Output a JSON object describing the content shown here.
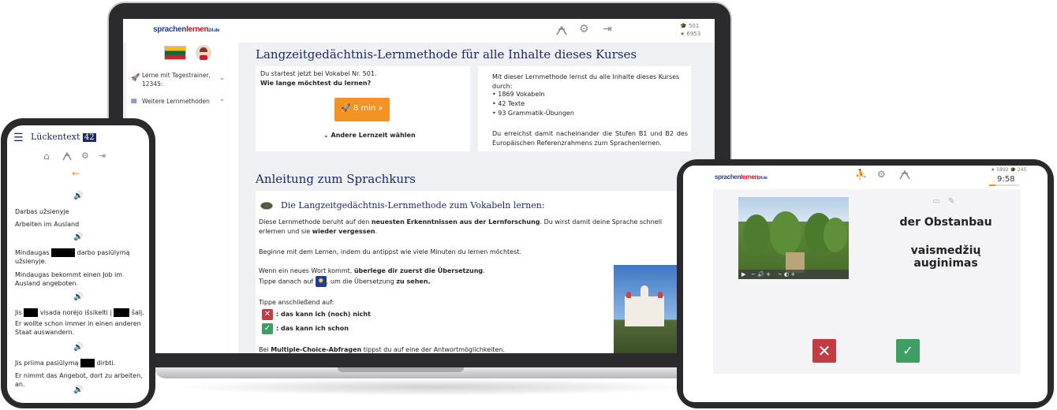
{
  "laptop": {
    "logo_a": "sprachen",
    "logo_b": "lernen",
    "logo_c": "24.de",
    "stats": {
      "line1": "501",
      "line2": "6953"
    },
    "sidebar": {
      "item1": "Lerne mit Tagestrainer, 12345:",
      "item2": "Weitere Lernmethoden"
    },
    "main_title": "Langzeitgedächtnis-Lernmethode für alle Inhalte dieses Kurses",
    "card_left": {
      "start_text": "Du startest jetzt bei Vokabel Nr. 501.",
      "question": "Wie lange möchtest du lernen?",
      "button": "8 min",
      "other_time": "Andere Lernzeit wählen"
    },
    "card_right": {
      "intro": "Mit dieser Lernmethode lernst du alle Inhalte dieses Kurses durch:",
      "items": [
        "1869 Vokabeln",
        "42 Texte",
        "93 Grammatik-Übungen"
      ],
      "outro": "Du erreichst damit nacheinander die Stufen B1 und B2 des Europäischen Referenzrahmens zum Sprachenlernen."
    },
    "guide_title": "Anleitung zum Sprachkurs",
    "guide_subtitle": "Die Langzeitgedächtnis-Lernmethode zum Vokabeln lernen:",
    "p1_a": "Diese Lernmethode beruht auf den ",
    "p1_b": "neuesten Erkenntnissen aus der Lernforschung",
    "p1_c": ". Du wirst damit deine Sprache schnell erlernen und sie ",
    "p1_d": "wieder vergessen",
    "p1_e": ".",
    "p2": "Beginne mit dem Lernen, indem du antippst wie viele Minuten du lernen möchtest.",
    "p3_a": "Wenn ein neues Wort kommt, ",
    "p3_b": "überlege dir zuerst die Übersetzung",
    "p3_c": ".",
    "p4_a": "Tippe danach auf ",
    "p4_b": ", um die Übersetzung ",
    "p4_c": "zu sehen.",
    "p5": "Tippe anschließend auf:",
    "no": ": das kann ich (noch) nicht",
    "yes": ": das kann ich schon",
    "p6_a": "Bei ",
    "p6_b": "Multiple-Choice-Abfragen",
    "p6_c": " tippst du auf eine der Antwortmöglichkeiten."
  },
  "phone": {
    "title": "Lückentext",
    "badge": "42",
    "lines": {
      "l1": "Darbas užsienyje",
      "l2": "Arbeiten im Ausland",
      "l3a": "Mindaugas",
      "l3b": "darbo",
      "l3c": "pasiūlymą užsienyje.",
      "l4": "Mindaugas bekommt einen Job im Ausland angeboten.",
      "l5a": "Jis",
      "l5b": "visada norėjo išsikelti į",
      "l5c": "šalį.",
      "l6": "Er wollte schon immer in einen anderen Staat auswandern.",
      "l7a": "Jis priima pasiūlymą",
      "l7b": "dirbti.",
      "l8": "Er nimmt das Angebot, dort zu arbeiten, an."
    }
  },
  "tablet": {
    "stats": {
      "line1": "5892",
      "line2": "245"
    },
    "timer": "9:58",
    "word_de": "der Obstanbau",
    "word_lt": "vaismedžių auginimas"
  },
  "colors": {
    "brand_blue": "#1c3f95",
    "brand_red": "#e30613",
    "orange": "#f39324",
    "no_red": "#c23c43",
    "yes_green": "#3e9e64"
  }
}
